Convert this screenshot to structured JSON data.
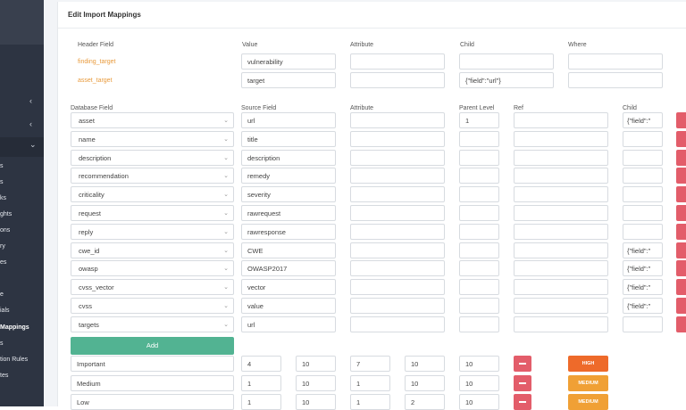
{
  "sidebar": {
    "items": [
      {
        "label": "s"
      },
      {
        "label": "s"
      },
      {
        "label": "ks"
      },
      {
        "label": "ghts"
      },
      {
        "label": "ons"
      },
      {
        "label": "ry"
      },
      {
        "label": "es"
      },
      {
        "label": "e"
      },
      {
        "label": "ials"
      },
      {
        "label": "Mappings"
      },
      {
        "label": "s"
      },
      {
        "label": "tion Rules"
      },
      {
        "label": "tes"
      }
    ],
    "chevrons": [
      "‹",
      "‹",
      "⌄"
    ]
  },
  "page": {
    "title": "Edit Import Mappings"
  },
  "header_section": {
    "columns": [
      "Header Field",
      "Value",
      "Attribute",
      "Child",
      "Where"
    ],
    "rows": [
      {
        "field": "finding_target",
        "value": "vulnerability",
        "attribute": "",
        "child": "",
        "where": ""
      },
      {
        "field": "asset_target",
        "value": "target",
        "attribute": "",
        "child": "{\"field\":\"url\"}",
        "where": ""
      }
    ]
  },
  "db_section": {
    "columns": [
      "Database Field",
      "Source Field",
      "Attribute",
      "Parent Level",
      "Ref",
      "Child"
    ],
    "rows": [
      {
        "db": "asset",
        "source": "url",
        "attribute": "",
        "parent": "1",
        "ref": "",
        "child": "{\"field\":\""
      },
      {
        "db": "name",
        "source": "title",
        "attribute": "",
        "parent": "",
        "ref": "",
        "child": ""
      },
      {
        "db": "description",
        "source": "description",
        "attribute": "",
        "parent": "",
        "ref": "",
        "child": ""
      },
      {
        "db": "recommendation",
        "source": "remedy",
        "attribute": "",
        "parent": "",
        "ref": "",
        "child": ""
      },
      {
        "db": "criticality",
        "source": "severity",
        "attribute": "",
        "parent": "",
        "ref": "",
        "child": ""
      },
      {
        "db": "request",
        "source": "rawrequest",
        "attribute": "",
        "parent": "",
        "ref": "",
        "child": ""
      },
      {
        "db": "reply",
        "source": "rawresponse",
        "attribute": "",
        "parent": "",
        "ref": "",
        "child": ""
      },
      {
        "db": "cwe_id",
        "source": "CWE",
        "attribute": "",
        "parent": "",
        "ref": "",
        "child": "{\"field\":\""
      },
      {
        "db": "owasp",
        "source": "OWASP2017",
        "attribute": "",
        "parent": "",
        "ref": "",
        "child": "{\"field\":\""
      },
      {
        "db": "cvss_vector",
        "source": "vector",
        "attribute": "",
        "parent": "",
        "ref": "",
        "child": "{\"field\":\""
      },
      {
        "db": "cvss",
        "source": "value",
        "attribute": "",
        "parent": "",
        "ref": "",
        "child": "{\"field\":\""
      },
      {
        "db": "targets",
        "source": "url",
        "attribute": "",
        "parent": "",
        "ref": "",
        "child": ""
      }
    ],
    "add_label": "Add"
  },
  "severity_section": {
    "rows": [
      {
        "name": "Important",
        "v1": "4",
        "v2": "10",
        "v3": "7",
        "v4": "10",
        "v5": "10",
        "badge": "HIGH",
        "badge_color": "#ee6a2a"
      },
      {
        "name": "Medium",
        "v1": "1",
        "v2": "10",
        "v3": "1",
        "v4": "10",
        "v5": "10",
        "badge": "MEDIUM",
        "badge_color": "#f0a035"
      },
      {
        "name": "Low",
        "v1": "1",
        "v2": "10",
        "v3": "1",
        "v4": "2",
        "v5": "10",
        "badge": "MEDIUM",
        "badge_color": "#f0a035"
      }
    ]
  }
}
